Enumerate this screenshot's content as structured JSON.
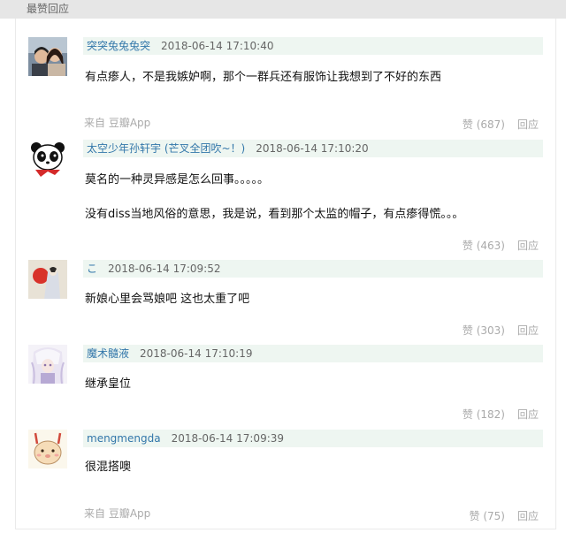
{
  "header": {
    "title": "最赞回应"
  },
  "comments": [
    {
      "author": "突突兔兔兔突",
      "time": "2018-06-14 17:10:40",
      "lines": [
        "有点瘆人，不是我嫉妒啊，那个一群兵还有服饰让我想到了不好的东西"
      ],
      "source": "来自 豆瓣App",
      "like_label": "赞 (687)",
      "reply_label": "回应"
    },
    {
      "author": "太空少年孙轩宇 (芒叉全团吹~！)",
      "time": "2018-06-14 17:10:20",
      "lines": [
        "莫名的一种灵异感是怎么回事。。。。。",
        "没有diss当地风俗的意思，我是说，看到那个太监的帽子，有点瘆得慌。。。"
      ],
      "source": "",
      "like_label": "赞 (463)",
      "reply_label": "回应"
    },
    {
      "author": "こ",
      "time": "2018-06-14 17:09:52",
      "lines": [
        "新娘心里会骂娘吧 这也太重了吧"
      ],
      "source": "",
      "like_label": "赞 (303)",
      "reply_label": "回应"
    },
    {
      "author": "魔术髓液",
      "time": "2018-06-14 17:10:19",
      "lines": [
        "继承皇位"
      ],
      "source": "",
      "like_label": "赞 (182)",
      "reply_label": "回应"
    },
    {
      "author": "mengmengda",
      "time": "2018-06-14 17:09:39",
      "lines": [
        "很混搭噢"
      ],
      "source": "来自 豆瓣App",
      "like_label": "赞 (75)",
      "reply_label": "回应"
    }
  ]
}
